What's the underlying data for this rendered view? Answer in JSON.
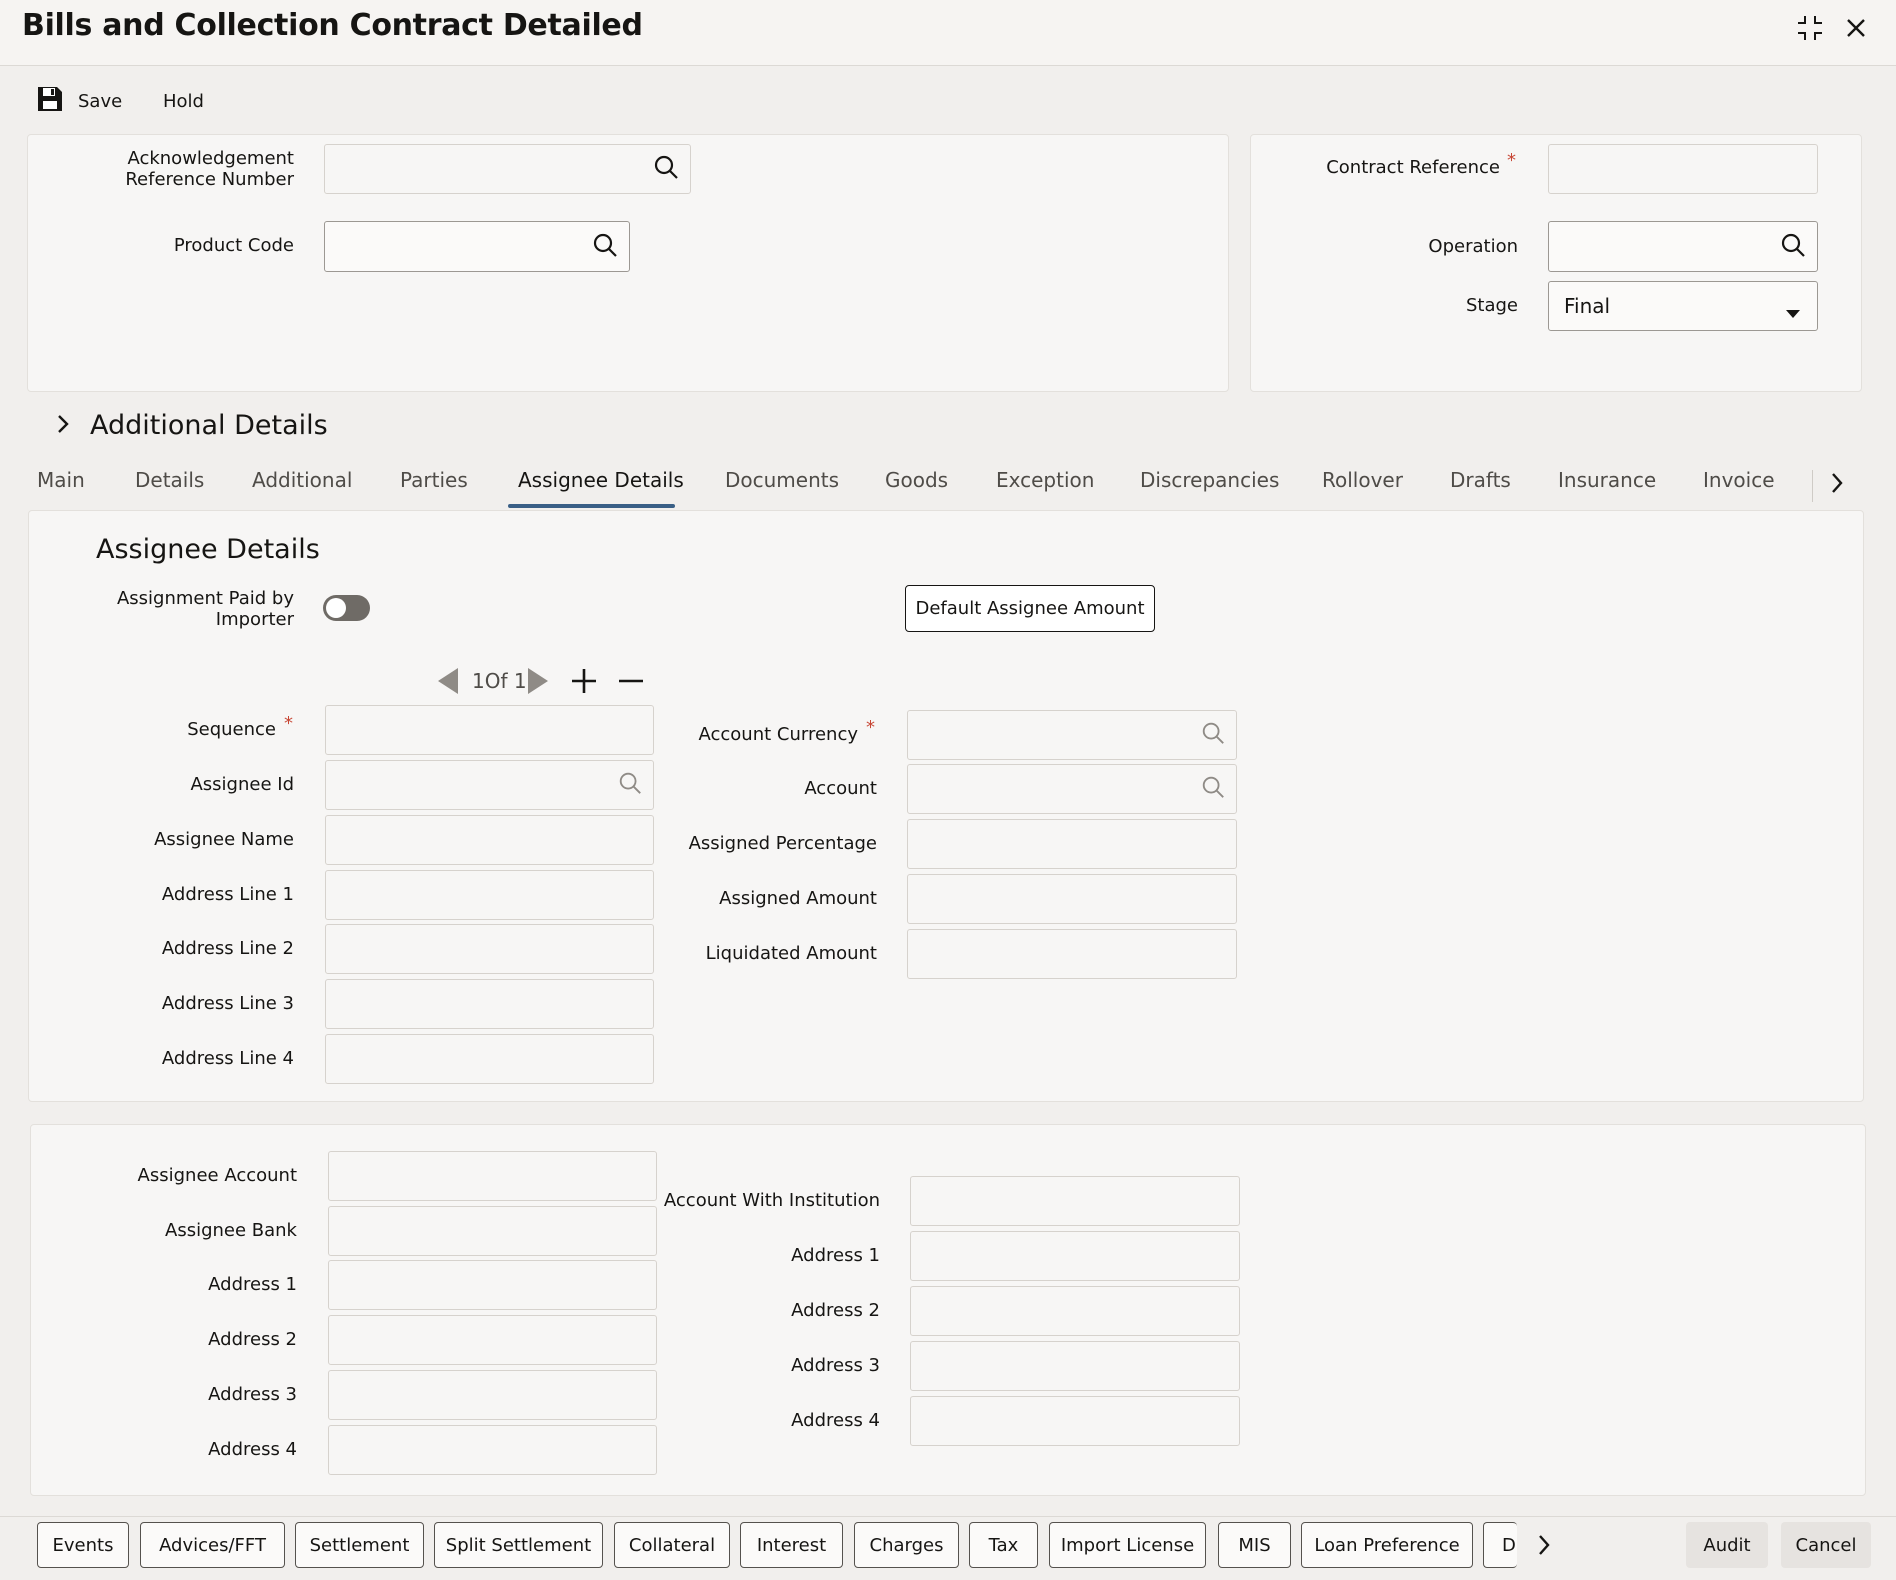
{
  "window": {
    "title": "Bills and Collection Contract Detailed",
    "icons": [
      "collapse-icon",
      "close-icon"
    ]
  },
  "toolbar": {
    "save_label": "Save",
    "hold_label": "Hold"
  },
  "header_form": {
    "ack_ref_label": "Acknowledgement Reference Number",
    "product_code_label": "Product Code",
    "contract_reference_label": "Contract Reference",
    "operation_label": "Operation",
    "stage_label": "Stage",
    "stage_value": "Final",
    "ack_ref_value": "",
    "product_code_value": "",
    "contract_reference_value": "",
    "operation_value": ""
  },
  "additional_details": {
    "label": "Additional Details"
  },
  "tabs": [
    {
      "label": "Main"
    },
    {
      "label": "Details"
    },
    {
      "label": "Additional"
    },
    {
      "label": "Parties"
    },
    {
      "label": "Assignee Details",
      "active": true
    },
    {
      "label": "Documents"
    },
    {
      "label": "Goods"
    },
    {
      "label": "Exception"
    },
    {
      "label": "Discrepancies"
    },
    {
      "label": "Rollover"
    },
    {
      "label": "Drafts"
    },
    {
      "label": "Insurance"
    },
    {
      "label": "Invoice"
    }
  ],
  "assignee": {
    "section_title": "Assignee Details",
    "paid_by_importer_label": "Assignment Paid by Importer",
    "paid_by_importer": false,
    "default_btn_label": "Default Assignee Amount",
    "pager": "1Of 1",
    "left_fields": [
      {
        "label": "Sequence",
        "required": true,
        "value": ""
      },
      {
        "label": "Assignee Id",
        "search": true,
        "value": ""
      },
      {
        "label": "Assignee Name",
        "value": ""
      },
      {
        "label": "Address Line 1",
        "value": ""
      },
      {
        "label": "Address Line 2",
        "value": ""
      },
      {
        "label": "Address Line 3",
        "value": ""
      },
      {
        "label": "Address Line 4",
        "value": ""
      }
    ],
    "right_fields": [
      {
        "label": "Account Currency",
        "required": true,
        "search": true,
        "value": ""
      },
      {
        "label": "Account",
        "search": true,
        "value": ""
      },
      {
        "label": "Assigned Percentage",
        "value": ""
      },
      {
        "label": "Assigned Amount",
        "value": ""
      },
      {
        "label": "Liquidated Amount",
        "value": ""
      }
    ]
  },
  "bank": {
    "left_fields": [
      {
        "label": "Assignee Account",
        "value": ""
      },
      {
        "label": "Assignee Bank",
        "value": ""
      },
      {
        "label": "Address 1",
        "value": ""
      },
      {
        "label": "Address 2",
        "value": ""
      },
      {
        "label": "Address 3",
        "value": ""
      },
      {
        "label": "Address 4",
        "value": ""
      }
    ],
    "right_fields": [
      {
        "label": "Account With Institution",
        "value": ""
      },
      {
        "label": "Address 1",
        "value": ""
      },
      {
        "label": "Address 2",
        "value": ""
      },
      {
        "label": "Address 3",
        "value": ""
      },
      {
        "label": "Address 4",
        "value": ""
      }
    ]
  },
  "footer": {
    "buttons": [
      "Events",
      "Advices/FFT",
      "Settlement",
      "Split Settlement",
      "Collateral",
      "Interest",
      "Charges",
      "Tax",
      "Import License",
      "MIS",
      "Loan Preference",
      "D"
    ],
    "audit_label": "Audit",
    "cancel_label": "Cancel"
  }
}
